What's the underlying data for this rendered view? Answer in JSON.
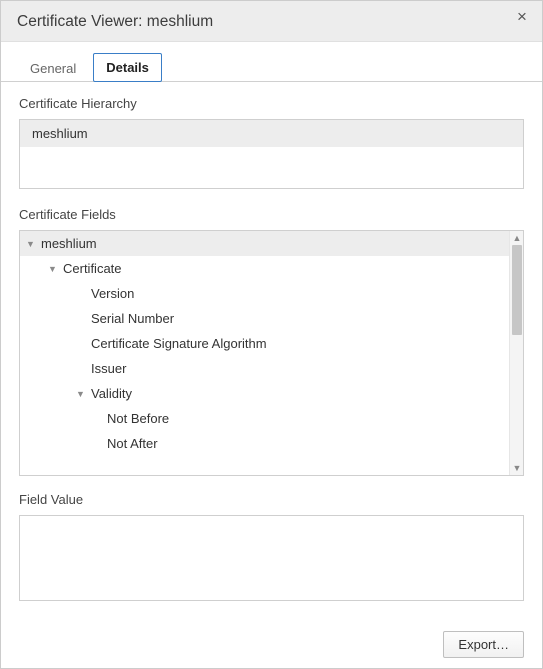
{
  "window": {
    "title": "Certificate Viewer: meshlium"
  },
  "tabs": {
    "general": "General",
    "details": "Details",
    "active": "details"
  },
  "hierarchy": {
    "label": "Certificate Hierarchy",
    "items": [
      "meshlium"
    ]
  },
  "fields": {
    "label": "Certificate Fields",
    "tree": {
      "root": "meshlium",
      "certificate": "Certificate",
      "version": "Version",
      "serial_number": "Serial Number",
      "sig_algo": "Certificate Signature Algorithm",
      "issuer": "Issuer",
      "validity": "Validity",
      "not_before": "Not Before",
      "not_after": "Not After"
    }
  },
  "field_value": {
    "label": "Field Value",
    "value": ""
  },
  "buttons": {
    "export": "Export…"
  }
}
